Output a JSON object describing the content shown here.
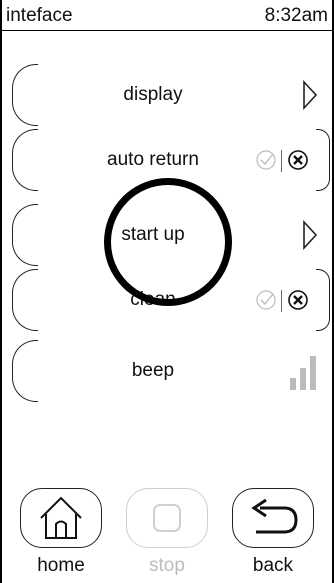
{
  "status_bar": {
    "title": "inteface",
    "time": "8:32am"
  },
  "menu": [
    {
      "label": "display",
      "control": "chevron-right-icon"
    },
    {
      "label": "auto return",
      "control": "check-x-toggle"
    },
    {
      "label": "start up",
      "control": "chevron-right-icon",
      "highlighted": true
    },
    {
      "label": "clean",
      "control": "check-x-toggle"
    },
    {
      "label": "beep",
      "control": "volume-level-icon",
      "volume_level_bars": 3
    }
  ],
  "bottom_nav": {
    "home": {
      "label": "home",
      "icon": "home-icon"
    },
    "stop": {
      "label": "stop",
      "icon": "stop-icon",
      "disabled": true
    },
    "back": {
      "label": "back",
      "icon": "back-arrow-icon"
    }
  },
  "colors": {
    "foreground": "#111111",
    "disabled": "#bdbdbd",
    "toggle_check": "#bbbbbb",
    "background": "#ffffff"
  }
}
